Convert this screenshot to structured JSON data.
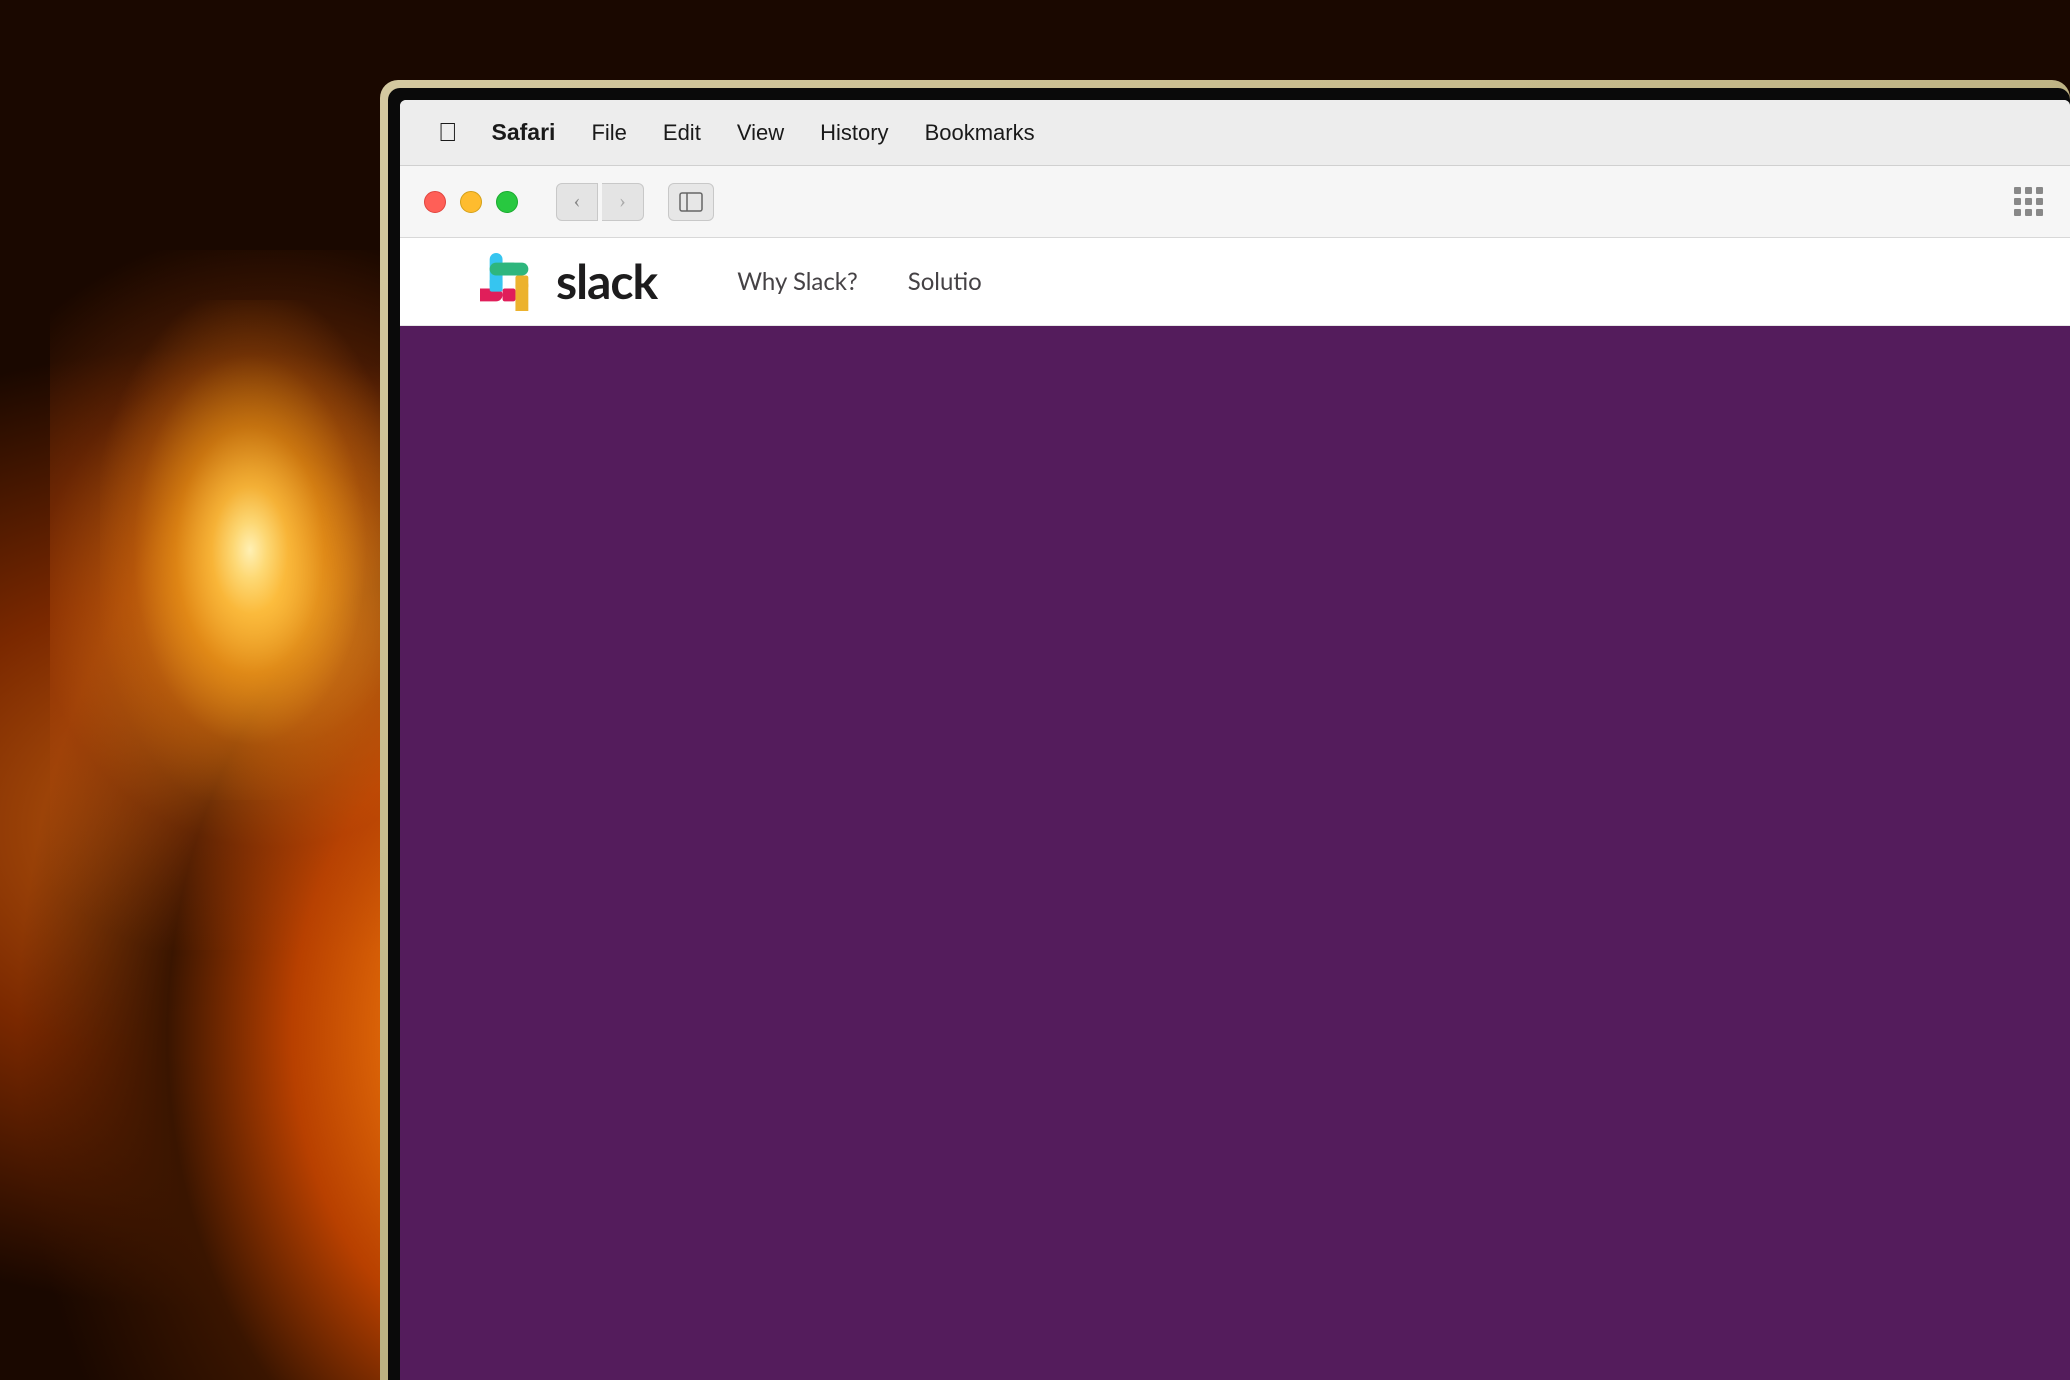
{
  "background": {
    "color": "#1a0a00"
  },
  "menubar": {
    "items": [
      {
        "id": "apple",
        "label": "",
        "bold": false,
        "apple": true
      },
      {
        "id": "safari",
        "label": "Safari",
        "bold": true
      },
      {
        "id": "file",
        "label": "File",
        "bold": false
      },
      {
        "id": "edit",
        "label": "Edit",
        "bold": false
      },
      {
        "id": "view",
        "label": "View",
        "bold": false
      },
      {
        "id": "history",
        "label": "History",
        "bold": false
      },
      {
        "id": "bookmarks",
        "label": "Bookmarks",
        "bold": false
      }
    ]
  },
  "toolbar": {
    "back_button_label": "‹",
    "forward_button_label": "›",
    "sidebar_toggle_label": "⊡"
  },
  "webpage": {
    "slack": {
      "logo_text": "slack",
      "nav_items": [
        {
          "id": "why-slack",
          "label": "Why Slack?"
        },
        {
          "id": "solutions",
          "label": "Solutio"
        }
      ],
      "hero_color": "#541c5c"
    }
  }
}
